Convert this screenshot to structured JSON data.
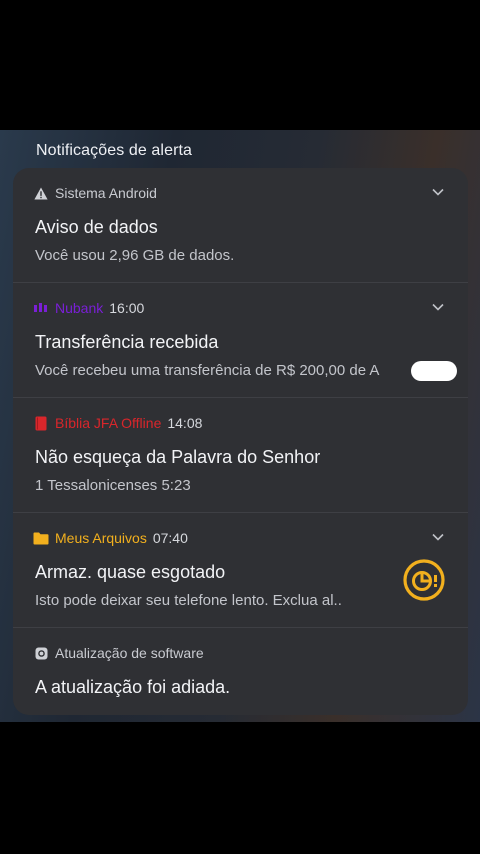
{
  "header": {
    "title": "Notificações de alerta"
  },
  "notifications": [
    {
      "app": "Sistema Android",
      "time": "",
      "title": "Aviso de dados",
      "body": "Você usou 2,96 GB de dados."
    },
    {
      "app": "Nubank",
      "time": "16:00",
      "title": "Transferência recebida",
      "body": "Você recebeu uma transferência de R$ 200,00 de A"
    },
    {
      "app": "Bíblia JFA Offline",
      "time": "14:08",
      "title": "Não esqueça da Palavra do Senhor",
      "body": "1 Tessalonicenses 5:23"
    },
    {
      "app": "Meus Arquivos",
      "time": "07:40",
      "title": "Armaz. quase esgotado",
      "body": "Isto pode deixar seu telefone lento. Exclua al.."
    },
    {
      "app": "Atualização de software",
      "time": "",
      "title": "A atualização foi adiada.",
      "body": ""
    }
  ],
  "colors": {
    "nubank": "#7a1fd6",
    "biblia": "#d9262b",
    "arquivos": "#f2b01e",
    "panel": "#2f3034"
  }
}
